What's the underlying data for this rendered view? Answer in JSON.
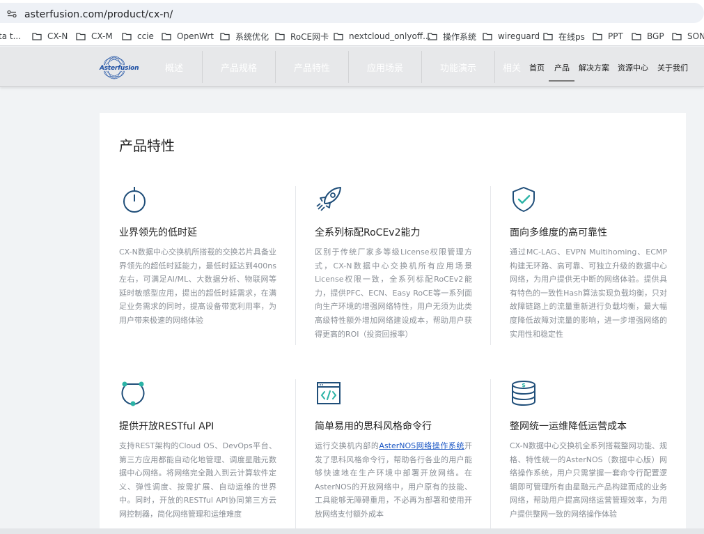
{
  "browser": {
    "url": "asterfusion.com/product/cx-n/",
    "bookmarks": [
      {
        "label": "ta t...",
        "icon": "folder-icon"
      },
      {
        "label": "CX-N",
        "icon": "folder-icon"
      },
      {
        "label": "CX-M",
        "icon": "folder-icon"
      },
      {
        "label": "ccie",
        "icon": "folder-icon"
      },
      {
        "label": "OpenWrt",
        "icon": "folder-icon"
      },
      {
        "label": "系统优化",
        "icon": "folder-icon"
      },
      {
        "label": "RoCE网卡",
        "icon": "folder-icon"
      },
      {
        "label": "nextcloud_onlyoff...",
        "icon": "folder-icon"
      },
      {
        "label": "操作系统",
        "icon": "folder-icon"
      },
      {
        "label": "wireguard",
        "icon": "folder-icon"
      },
      {
        "label": "在线ps",
        "icon": "folder-icon"
      },
      {
        "label": "PPT",
        "icon": "folder-icon"
      },
      {
        "label": "BGP",
        "icon": "folder-icon"
      },
      {
        "label": "SONi",
        "icon": "folder-icon"
      }
    ]
  },
  "header": {
    "logo_text": "Asterfusion",
    "subnav": [
      "概述",
      "产品规格",
      "产品特性",
      "应用场景",
      "功能演示",
      "相关"
    ],
    "mainnav": [
      "首页",
      "产品",
      "解决方案",
      "资源中心",
      "关于我们"
    ],
    "mainnav_active": "产品"
  },
  "section": {
    "title": "产品特性",
    "features": [
      {
        "icon": "stopwatch-icon",
        "title": "业界领先的低时延",
        "desc": "CX-N数据中心交换机所搭载的交换芯片具备业界领先的超低时延能力，最低时延达到400ns左右，可满足AI/ML、大数据分析、物联网等延时敏感型应用，提出的超低时延需求，在满足业务需求的同时，提高设备带宽利用率，为用户带来极速的网络体验"
      },
      {
        "icon": "rocket-icon",
        "title": "全系列标配RoCEv2能力",
        "desc": "区别于传统厂家多等级License权限管理方式，CX-N数据中心交换机所有应用场景License权限一致，全系列标配RoCEv2能力，提供PFC、ECN、Easy RoCE等一系列面向生产环境的增强网络特性，用户无须为此类高级特性额外增加网络建设成本，帮助用户获得更高的ROI（投资回报率）"
      },
      {
        "icon": "shield-check-icon",
        "title": "面向多维度的高可靠性",
        "desc": "通过MC-LAG、EVPN Multihoming、ECMP构建无环路、高可靠、可独立升级的数据中心网络，为用户提供无中断的网络体验。提供具有特色的一致性Hash算法实现负载均衡，只对故障链路上的流量重新进行负载均衡，最大幅度降低故障对流量的影响，进一步增强网络的实用性和稳定性"
      },
      {
        "icon": "api-nodes-icon",
        "title": "提供开放RESTful API",
        "desc": "支持REST架构的Cloud OS、DevOps平台、第三方应用都能自动化地管理、调度星融元数据中心网络。将网络完全融入到云计算软件定义、弹性调度、按需扩展、自动运维的世界中。同时，开放的RESTful API协同第三方云网控制器，简化网络管理和运维难度"
      },
      {
        "icon": "code-window-icon",
        "title": "简单易用的思科风格命令行",
        "desc_pre": "运行交换机内部的",
        "desc_link": "AsterNOS网络操作系统",
        "desc_post": "开发了思科风格命令行，帮助各行各业的用户能够快速地在生产环境中部署开放网络。在AsterNOS的开放网络中，用户原有的技能、工具能够无障碍重用，不必再为部署和使用开放网络支付额外成本"
      },
      {
        "icon": "database-icon",
        "title": "整网统一运维降低运营成本",
        "desc": "CX-N数据中心交换机全系列搭载整网功能、规格、特性统一的AsterNOS（数据中心版）网络操作系统，用户只需掌握一套命令行配置逻辑即可管理所有由星融元产品构建而成的业务网络，帮助用户提高网络运营管理效率，为用户提供整网一致的网络操作体验"
      }
    ]
  },
  "colors": {
    "accent": "#1f4e79",
    "link": "#1a56c4",
    "desc_text": "#8a8f96"
  }
}
